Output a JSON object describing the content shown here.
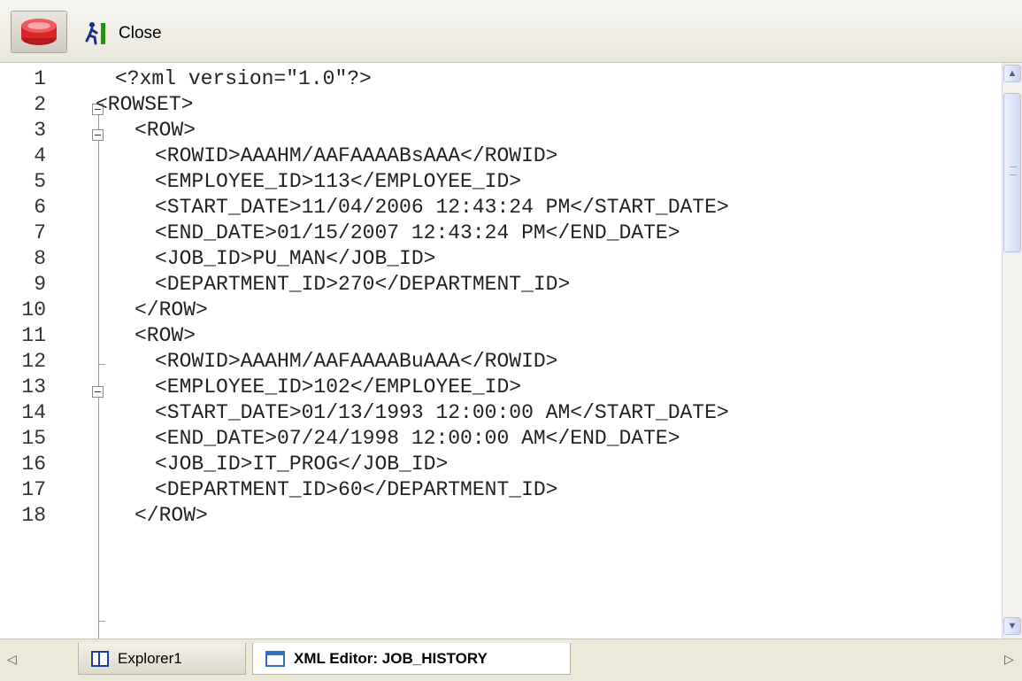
{
  "toolbar": {
    "database_icon": "database-icon",
    "close_icon": "exit-runner-icon",
    "close_label": "Close"
  },
  "editor": {
    "lines": [
      {
        "num": "1",
        "text": "<?xml version=\"1.0\"?>"
      },
      {
        "num": "2",
        "text": "<ROWSET>"
      },
      {
        "num": "3",
        "text": "<ROW>"
      },
      {
        "num": "4",
        "text": "<ROWID>AAAHM/AAFAAAABsAAA</ROWID>"
      },
      {
        "num": "5",
        "text": "<EMPLOYEE_ID>113</EMPLOYEE_ID>"
      },
      {
        "num": "6",
        "text": "<START_DATE>11/04/2006 12:43:24 PM</START_DATE>"
      },
      {
        "num": "7",
        "text": "<END_DATE>01/15/2007 12:43:24 PM</END_DATE>"
      },
      {
        "num": "8",
        "text": "<JOB_ID>PU_MAN</JOB_ID>"
      },
      {
        "num": "9",
        "text": "<DEPARTMENT_ID>270</DEPARTMENT_ID>"
      },
      {
        "num": "10",
        "text": "</ROW>"
      },
      {
        "num": "11",
        "text": "<ROW>"
      },
      {
        "num": "12",
        "text": "<ROWID>AAAHM/AAFAAAABuAAA</ROWID>"
      },
      {
        "num": "13",
        "text": "<EMPLOYEE_ID>102</EMPLOYEE_ID>"
      },
      {
        "num": "14",
        "text": "<START_DATE>01/13/1993 12:00:00 AM</START_DATE>"
      },
      {
        "num": "15",
        "text": "<END_DATE>07/24/1998 12:00:00 AM</END_DATE>"
      },
      {
        "num": "16",
        "text": "<JOB_ID>IT_PROG</JOB_ID>"
      },
      {
        "num": "17",
        "text": "<DEPARTMENT_ID>60</DEPARTMENT_ID>"
      },
      {
        "num": "18",
        "text": "</ROW>"
      }
    ]
  },
  "tabs": [
    {
      "label": "Explorer1",
      "icon": "panel-icon",
      "active": false
    },
    {
      "label": "XML Editor: JOB_HISTORY",
      "icon": "window-icon",
      "active": true
    }
  ]
}
